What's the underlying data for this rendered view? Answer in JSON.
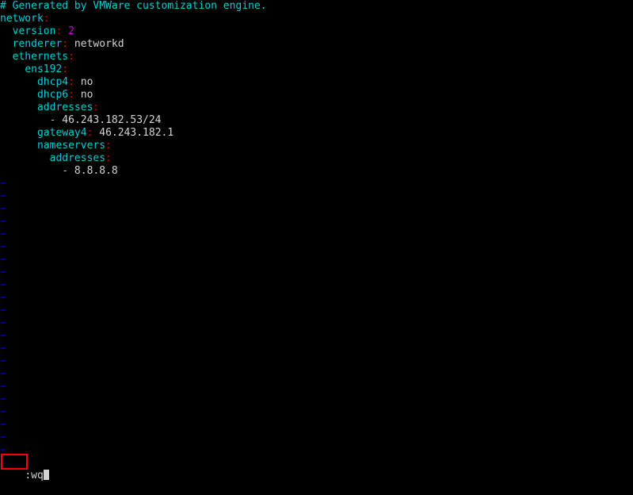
{
  "terminal": {
    "background_color": "#000000",
    "foreground_color": "#d4d4d4",
    "editor": "vim",
    "columns": 100,
    "rows": 37
  },
  "colors": {
    "comment": "#00cdd7",
    "key": "#00cdd7",
    "colon": "#cd0000",
    "number": "#cd00cd",
    "string": "#d4d4d4",
    "dash": "#cdcd00",
    "tilde": "#0000ee",
    "highlight_box": "#ff0000"
  },
  "buffer": {
    "lines": [
      {
        "indent": "",
        "segments": [
          {
            "text": "# Generated by VMWare customization engine.",
            "color": "comment"
          }
        ]
      },
      {
        "indent": "",
        "segments": [
          {
            "text": "network",
            "color": "key"
          },
          {
            "text": ":",
            "color": "colon"
          }
        ]
      },
      {
        "indent": "  ",
        "segments": [
          {
            "text": "version",
            "color": "key"
          },
          {
            "text": ":",
            "color": "colon"
          },
          {
            "text": " ",
            "color": "string"
          },
          {
            "text": "2",
            "color": "number"
          }
        ]
      },
      {
        "indent": "  ",
        "segments": [
          {
            "text": "renderer",
            "color": "key"
          },
          {
            "text": ":",
            "color": "colon"
          },
          {
            "text": " networkd",
            "color": "string"
          }
        ]
      },
      {
        "indent": "  ",
        "segments": [
          {
            "text": "ethernets",
            "color": "key"
          },
          {
            "text": ":",
            "color": "colon"
          }
        ]
      },
      {
        "indent": "    ",
        "segments": [
          {
            "text": "ens192",
            "color": "key"
          },
          {
            "text": ":",
            "color": "colon"
          }
        ]
      },
      {
        "indent": "      ",
        "segments": [
          {
            "text": "dhcp4",
            "color": "key"
          },
          {
            "text": ":",
            "color": "colon"
          },
          {
            "text": " no",
            "color": "string"
          }
        ]
      },
      {
        "indent": "      ",
        "segments": [
          {
            "text": "dhcp6",
            "color": "key"
          },
          {
            "text": ":",
            "color": "colon"
          },
          {
            "text": " no",
            "color": "string"
          }
        ]
      },
      {
        "indent": "      ",
        "segments": [
          {
            "text": "addresses",
            "color": "key"
          },
          {
            "text": ":",
            "color": "colon"
          }
        ]
      },
      {
        "indent": "        ",
        "segments": [
          {
            "text": "-",
            "color": "dash"
          },
          {
            "text": " 46.243.182.53/24",
            "color": "string"
          }
        ]
      },
      {
        "indent": "      ",
        "segments": [
          {
            "text": "gateway4",
            "color": "key"
          },
          {
            "text": ":",
            "color": "colon"
          },
          {
            "text": " 46.243.182.1",
            "color": "string"
          }
        ]
      },
      {
        "indent": "      ",
        "segments": [
          {
            "text": "nameservers",
            "color": "key"
          },
          {
            "text": ":",
            "color": "colon"
          }
        ]
      },
      {
        "indent": "        ",
        "segments": [
          {
            "text": "addresses",
            "color": "key"
          },
          {
            "text": ":",
            "color": "colon"
          }
        ]
      },
      {
        "indent": "          ",
        "segments": [
          {
            "text": "-",
            "color": "dash"
          },
          {
            "text": " 8.8.8.8",
            "color": "string"
          }
        ]
      }
    ],
    "empty_marker": "~",
    "empty_line_count": 22
  },
  "statusline": {
    "command": ":wq",
    "cursor": "block"
  },
  "annotation": {
    "type": "highlight-rectangle",
    "target": ":wq",
    "color": "#ff0000"
  }
}
